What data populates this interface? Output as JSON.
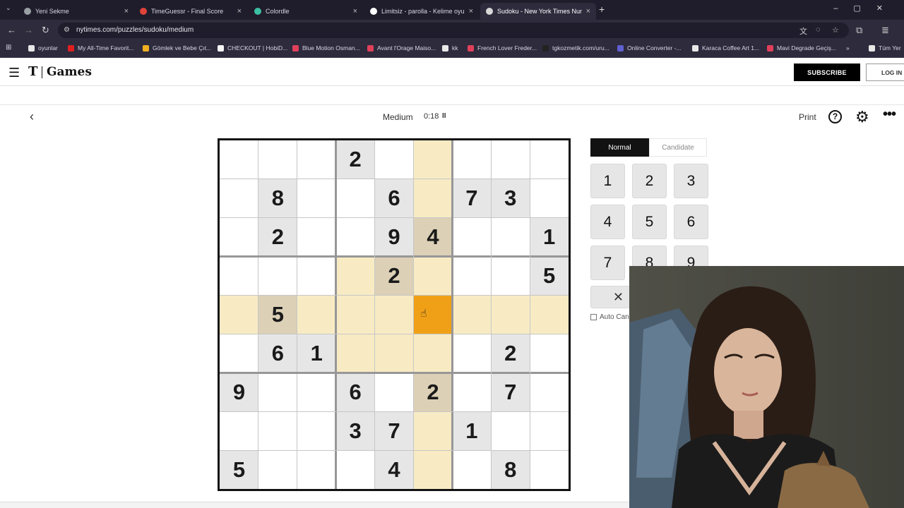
{
  "browser": {
    "tabs": [
      {
        "title": "Yeni Sekme",
        "favicon_color": "#9aa0a6",
        "active": false
      },
      {
        "title": "TimeGuessr - Final Score",
        "favicon_color": "#e0433a",
        "active": false
      },
      {
        "title": "Colordle",
        "favicon_color": "#3cc0a4",
        "active": false
      },
      {
        "title": "Limitsiz - parolla - Kelime oyun",
        "favicon_color": "#ffffff",
        "active": false
      },
      {
        "title": "Sudoku - New York Times Num",
        "favicon_color": "#d8d8d8",
        "active": true
      }
    ],
    "url": "nytimes.com/puzzles/sudoku/medium",
    "bookmarks": [
      {
        "label": "oyunlar",
        "color": "#e8e8e8"
      },
      {
        "label": "My All-Time Favorit...",
        "color": "#e02020"
      },
      {
        "label": "Gömlek ve Bebe Çıt...",
        "color": "#f0b020"
      },
      {
        "label": "CHECKOUT | HobiD...",
        "color": "#f5f5f5"
      },
      {
        "label": "Blue Motion Osman...",
        "color": "#e0405a"
      },
      {
        "label": "Avant l'Orage Maiso...",
        "color": "#e0405a"
      },
      {
        "label": "kk",
        "color": "#e8e8e8"
      },
      {
        "label": "French Lover Freder...",
        "color": "#e0405a"
      },
      {
        "label": "tgkozmetik.com/uru...",
        "color": "#222222"
      },
      {
        "label": "Online Converter -...",
        "color": "#6060d0"
      },
      {
        "label": "Karaca Coffee Art 1...",
        "color": "#e8e8e8"
      },
      {
        "label": "Mavi Degrade Geçiş...",
        "color": "#e0405a"
      },
      {
        "label": "Tüm Yer",
        "color": "#e8e8e8"
      }
    ]
  },
  "header": {
    "logo_t": "T",
    "logo_games": "Games",
    "subscribe_label": "SUBSCRIBE",
    "login_label": "LOG IN"
  },
  "toolbar": {
    "difficulty": "Medium",
    "timer": "0:18",
    "pause_icon": "II",
    "print_label": "Print",
    "help_label": "?"
  },
  "board": {
    "grid": [
      [
        0,
        0,
        0,
        2,
        0,
        0,
        0,
        0,
        0
      ],
      [
        0,
        8,
        0,
        0,
        6,
        0,
        7,
        3,
        0
      ],
      [
        0,
        2,
        0,
        0,
        9,
        4,
        0,
        0,
        1
      ],
      [
        0,
        0,
        0,
        0,
        2,
        0,
        0,
        0,
        5
      ],
      [
        0,
        5,
        0,
        0,
        0,
        0,
        0,
        0,
        0
      ],
      [
        0,
        6,
        1,
        0,
        0,
        0,
        0,
        2,
        0
      ],
      [
        9,
        0,
        0,
        6,
        0,
        2,
        0,
        7,
        0
      ],
      [
        0,
        0,
        0,
        3,
        7,
        0,
        1,
        0,
        0
      ],
      [
        5,
        0,
        0,
        0,
        4,
        0,
        0,
        8,
        0
      ]
    ],
    "selected": {
      "row": 4,
      "col": 5
    },
    "colors": {
      "given": "#e6e6e6",
      "highlight": "#f8ebc4",
      "highlight_given": "#dcd0b6",
      "selected": "#f0a016"
    }
  },
  "panel": {
    "mode_normal": "Normal",
    "mode_candidate": "Candidate",
    "keys": [
      "1",
      "2",
      "3",
      "4",
      "5",
      "6",
      "7",
      "8",
      "9"
    ],
    "erase_icon": "✕",
    "auto_candidate_label": "Auto Cand"
  }
}
